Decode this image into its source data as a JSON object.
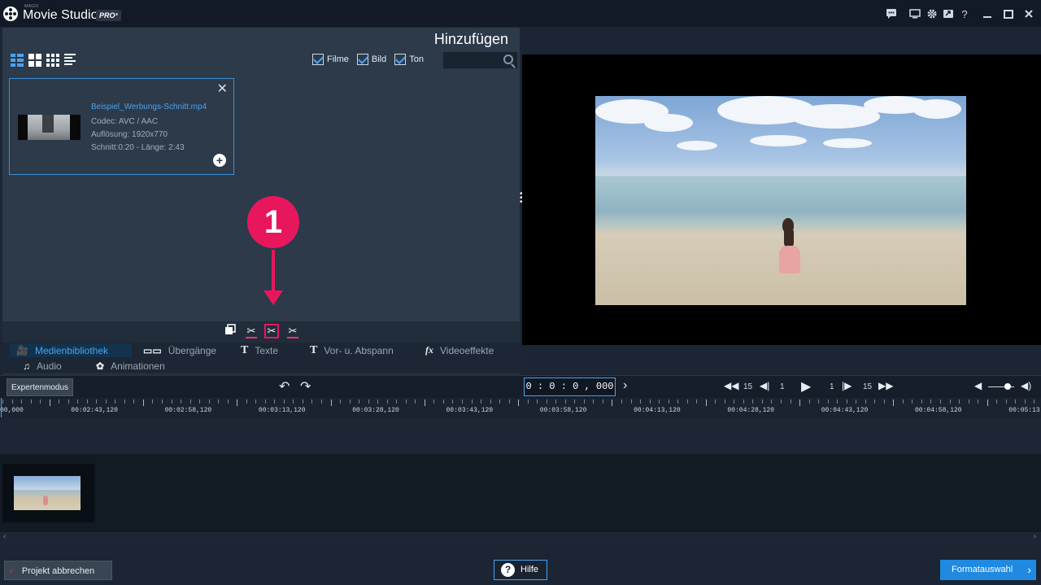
{
  "app": {
    "brand_small": "MAGIX",
    "title": "Movie Studio",
    "badge": "PRO³"
  },
  "titlebar_icons": [
    "chat-icon",
    "monitor-icon",
    "gear-icon",
    "export-icon",
    "help-icon",
    "minimize-icon",
    "maximize-icon",
    "close-icon"
  ],
  "panel": {
    "heading": "Hinzufügen",
    "filters": [
      {
        "label": "Filme",
        "checked": true
      },
      {
        "label": "Bild",
        "checked": true
      },
      {
        "label": "Ton",
        "checked": true
      }
    ],
    "search_placeholder": "",
    "media_item": {
      "filename": "Beispiel_Werbungs-Schnitt.mp4",
      "codec": "Codec: AVC / AAC",
      "resolution": "Auflösung: 1920x770",
      "cut_length": "Schnitt:0:20 - Länge: 2:43"
    }
  },
  "callout": {
    "number": "1",
    "color": "#e8175d"
  },
  "tabs": [
    {
      "label": "Medienbibliothek",
      "active": true
    },
    {
      "label": "Übergänge",
      "active": false
    },
    {
      "label": "Texte",
      "active": false
    },
    {
      "label": "Vor- u. Abspann",
      "active": false
    },
    {
      "label": "Videoeffekte",
      "active": false
    },
    {
      "label": "Audio",
      "active": false
    },
    {
      "label": "Animationen",
      "active": false
    }
  ],
  "controls": {
    "expert_mode": "Expertenmodus",
    "timecode": "0 : 0 : 0 , 000",
    "skip_back_value": "15",
    "frame_back_value": "1",
    "frame_forward_value": "1",
    "skip_forward_value": "15",
    "volume_level": 0.75
  },
  "ruler": {
    "labels": [
      "00,000",
      "00:02:43,120",
      "00:02:58,120",
      "00:03:13,120",
      "00:03:28,120",
      "00:03:43,120",
      "00:03:58,120",
      "00:04:13,120",
      "00:04:28,120",
      "00:04:43,120",
      "00:04:58,120",
      "00:05:13"
    ]
  },
  "bottom": {
    "cancel": "Projekt abbrechen",
    "help": "Hilfe",
    "format": "Formatauswahl"
  },
  "colors": {
    "accent": "#4aa3f0",
    "highlight": "#e8175d",
    "primary_button": "#1f8ae0"
  }
}
